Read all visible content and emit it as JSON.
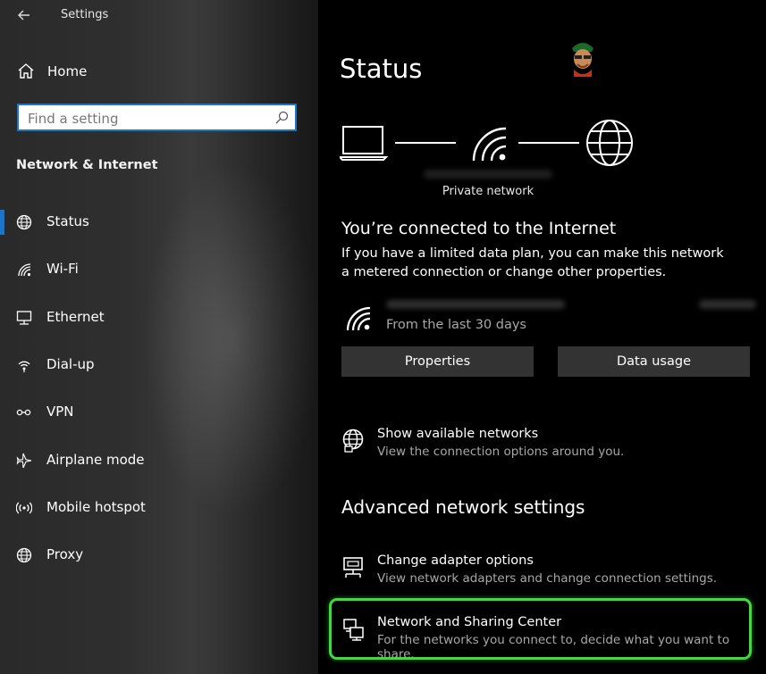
{
  "window": {
    "title": "Settings"
  },
  "sidebar": {
    "home_label": "Home",
    "search_placeholder": "Find a setting",
    "category": "Network & Internet",
    "items": [
      {
        "label": "Status",
        "icon": "globe-status-icon",
        "active": true
      },
      {
        "label": "Wi-Fi",
        "icon": "wifi-icon"
      },
      {
        "label": "Ethernet",
        "icon": "ethernet-icon"
      },
      {
        "label": "Dial-up",
        "icon": "dialup-icon"
      },
      {
        "label": "VPN",
        "icon": "vpn-icon"
      },
      {
        "label": "Airplane mode",
        "icon": "airplane-icon"
      },
      {
        "label": "Mobile hotspot",
        "icon": "hotspot-icon"
      },
      {
        "label": "Proxy",
        "icon": "globe-icon"
      }
    ]
  },
  "main": {
    "title": "Status",
    "network_type": "Private network",
    "connected_heading": "You’re connected to the Internet",
    "connected_text": "If you have a limited data plan, you can make this network a metered connection or change other properties.",
    "usage_period": "From the last 30 days",
    "buttons": {
      "properties": "Properties",
      "data_usage": "Data usage"
    },
    "show_networks": {
      "title": "Show available networks",
      "subtitle": "View the connection options around you."
    },
    "advanced_heading": "Advanced network settings",
    "adapter_options": {
      "title": "Change adapter options",
      "subtitle": "View network adapters and change connection settings."
    },
    "sharing_center": {
      "title": "Network and Sharing Center",
      "subtitle": "For the networks you connect to, decide what you want to share."
    }
  },
  "colors": {
    "accent": "#1a76c8",
    "highlight": "#3ddc3a",
    "button_bg": "#333333"
  }
}
